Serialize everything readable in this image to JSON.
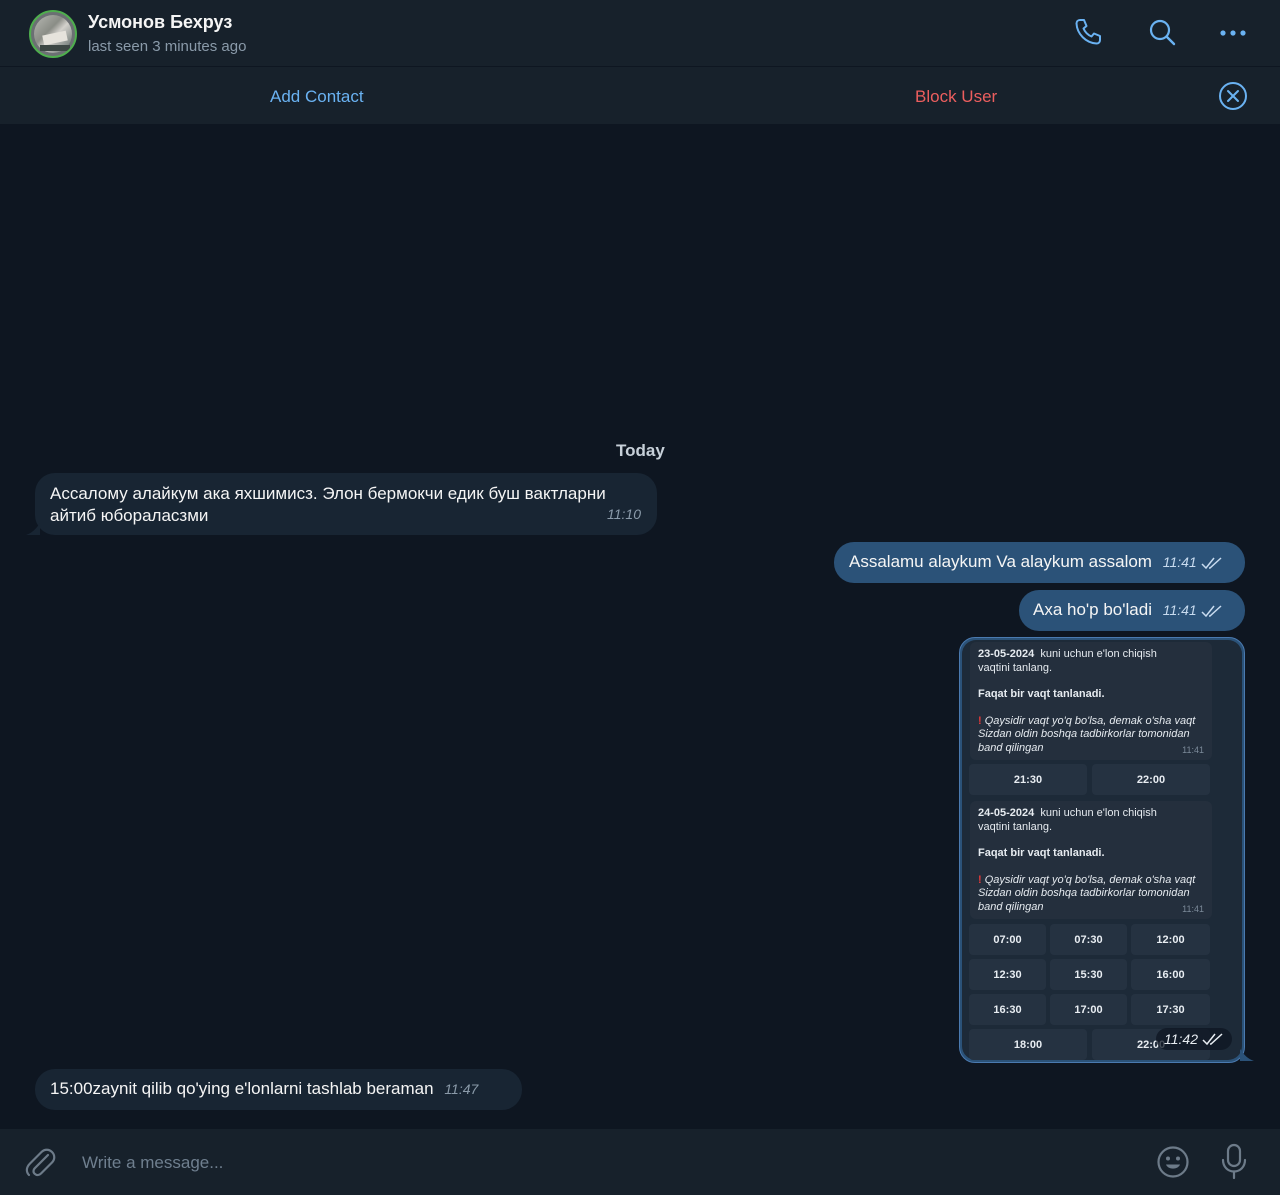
{
  "header": {
    "name": "Усмонов Бехруз",
    "status": "last seen 3 minutes ago",
    "icons": [
      "phone-icon",
      "search-icon",
      "more-icon"
    ]
  },
  "actions": {
    "add_contact": "Add Contact",
    "block_user": "Block User"
  },
  "chat": {
    "date_separator": "Today",
    "messages": [
      {
        "direction": "in",
        "text": "Ассалому алайкум ака яхшимисз. Элон бермокчи едик буш вактларни айтиб юбораласзми",
        "time": "11:10"
      },
      {
        "direction": "out",
        "text": "Assalamu alaykum Va alaykum assalom",
        "time": "11:41"
      },
      {
        "direction": "out",
        "text": "Axa ho'p bo'ladi",
        "time": "11:41"
      },
      {
        "direction": "in",
        "text": "15:00zaynit qilib qo'ying e'lonlarni tashlab beraman",
        "time": "11:47"
      }
    ],
    "image_message": {
      "time": "11:42",
      "card1": {
        "date": "23-05-2024",
        "line1": "kuni uchun e'lon chiqish",
        "line2": "vaqtini tanlang.",
        "bold": "Faqat bir vaqt tanlanadi.",
        "warning": "Qaysidir vaqt yo'q bo'lsa, demak o'sha vaqt Sizdan oldin boshqa tadbirkorlar tomonidan band qilingan",
        "time": "11:41",
        "buttons": [
          "21:30",
          "22:00"
        ]
      },
      "card2": {
        "date": "24-05-2024",
        "line1": "kuni uchun e'lon chiqish",
        "line2": "vaqtini tanlang.",
        "bold": "Faqat bir vaqt tanlanadi.",
        "warning": "Qaysidir vaqt yo'q bo'lsa, demak o'sha vaqt Sizdan oldin boshqa tadbirkorlar tomonidan band qilingan",
        "time": "11:41",
        "buttons": [
          "07:00",
          "07:30",
          "12:00",
          "12:30",
          "15:30",
          "16:00",
          "16:30",
          "17:00",
          "17:30",
          "18:00",
          "22:00"
        ]
      }
    }
  },
  "composer": {
    "placeholder": "Write a message..."
  },
  "colors": {
    "accent": "#6ab2f2",
    "danger": "#ec5e5e",
    "outgoing_bubble": "#2b5278",
    "incoming_bubble": "#182533"
  }
}
